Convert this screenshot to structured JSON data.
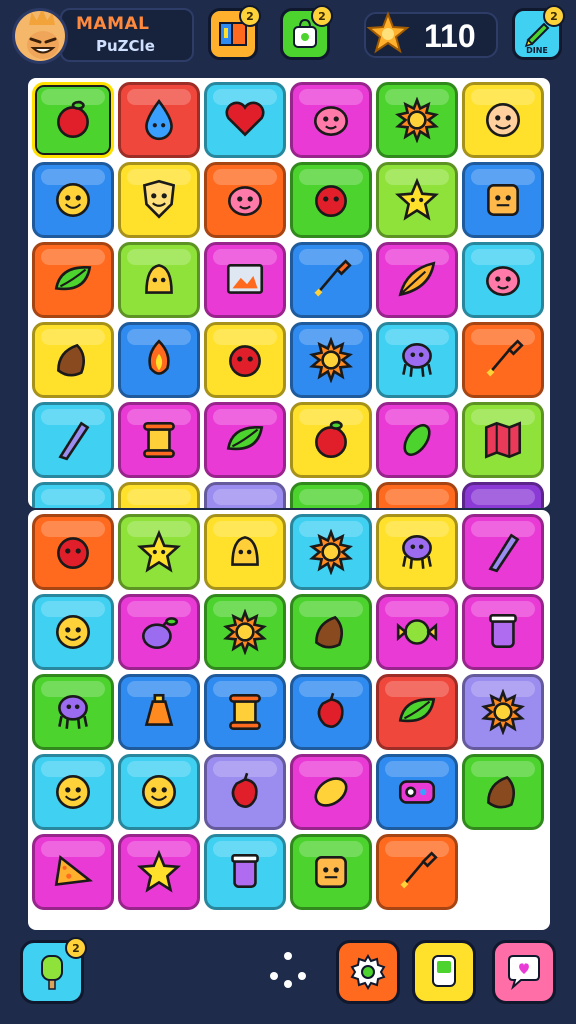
{
  "header": {
    "player_name": "MAMAL",
    "player_subtitle": "PuZCle",
    "coins": "110",
    "badges": {
      "map": "2",
      "shop": "2",
      "edit": "2",
      "hint": "2"
    },
    "edit_label": "DINE"
  },
  "colors": {
    "background": "#1f2b4a",
    "green": "#4cd32e",
    "red": "#f0473c",
    "cyan": "#3fd0f2",
    "magenta": "#e93ad6",
    "yellow": "#ffe02a",
    "orange": "#ff6a1f",
    "blue": "#2f8bf0",
    "lime": "#8fe23a",
    "lavender": "#9b8cf0",
    "purple": "#8c3ad6"
  },
  "board_top": [
    [
      {
        "color": "green",
        "icon": "apple-icon"
      },
      {
        "color": "red",
        "icon": "water-drop-icon"
      },
      {
        "color": "cyan",
        "icon": "heart-icon"
      },
      {
        "color": "magenta",
        "icon": "blob-face-icon"
      },
      {
        "color": "green",
        "icon": "sun-icon"
      },
      {
        "color": "yellow",
        "icon": "face-icon"
      }
    ],
    [
      {
        "color": "blue",
        "icon": "smiley-icon"
      },
      {
        "color": "yellow",
        "icon": "shield-face-icon"
      },
      {
        "color": "orange",
        "icon": "blob-face-icon"
      },
      {
        "color": "green",
        "icon": "tomato-icon"
      },
      {
        "color": "lime",
        "icon": "star-face-icon"
      },
      {
        "color": "blue",
        "icon": "box-face-icon"
      }
    ],
    [
      {
        "color": "orange",
        "icon": "leaf-icon"
      },
      {
        "color": "lime",
        "icon": "bell-face-icon"
      },
      {
        "color": "magenta",
        "icon": "picture-icon"
      },
      {
        "color": "blue",
        "icon": "brush-icon"
      },
      {
        "color": "magenta",
        "icon": "feather-icon"
      },
      {
        "color": "cyan",
        "icon": "blob-face-icon"
      }
    ],
    [
      {
        "color": "yellow",
        "icon": "nut-icon"
      },
      {
        "color": "blue",
        "icon": "flame-icon"
      },
      {
        "color": "yellow",
        "icon": "tomato-icon"
      },
      {
        "color": "blue",
        "icon": "sun-icon"
      },
      {
        "color": "cyan",
        "icon": "octopus-icon"
      },
      {
        "color": "orange",
        "icon": "brush-icon"
      }
    ],
    [
      {
        "color": "cyan",
        "icon": "crystal-icon"
      },
      {
        "color": "magenta",
        "icon": "scroll-icon"
      },
      {
        "color": "magenta",
        "icon": "leaf-icon"
      },
      {
        "color": "yellow",
        "icon": "apple-icon"
      },
      {
        "color": "magenta",
        "icon": "pickle-icon"
      },
      {
        "color": "lime",
        "icon": "map-icon"
      }
    ]
  ],
  "board_top_peek": [
    "cyan",
    "yellow",
    "lavender",
    "green",
    "orange",
    "purple"
  ],
  "board_bottom": [
    [
      {
        "color": "orange",
        "icon": "tomato-icon"
      },
      {
        "color": "lime",
        "icon": "star-face-icon"
      },
      {
        "color": "yellow",
        "icon": "bell-face-icon"
      },
      {
        "color": "cyan",
        "icon": "sun-icon"
      },
      {
        "color": "yellow",
        "icon": "octopus-icon"
      },
      {
        "color": "magenta",
        "icon": "crystal-icon"
      }
    ],
    [
      {
        "color": "cyan",
        "icon": "smiley-icon"
      },
      {
        "color": "magenta",
        "icon": "plum-icon"
      },
      {
        "color": "green",
        "icon": "sun-icon"
      },
      {
        "color": "green",
        "icon": "nut-icon"
      },
      {
        "color": "magenta",
        "icon": "candy-icon"
      },
      {
        "color": "magenta",
        "icon": "jar-icon"
      }
    ],
    [
      {
        "color": "green",
        "icon": "octopus-icon"
      },
      {
        "color": "blue",
        "icon": "bell-icon"
      },
      {
        "color": "blue",
        "icon": "scroll-icon"
      },
      {
        "color": "blue",
        "icon": "pepper-icon"
      },
      {
        "color": "red",
        "icon": "leaf-icon"
      },
      {
        "color": "lavender",
        "icon": "sun-icon"
      }
    ],
    [
      {
        "color": "cyan",
        "icon": "smiley-icon"
      },
      {
        "color": "cyan",
        "icon": "smiley-icon"
      },
      {
        "color": "lavender",
        "icon": "pepper-icon"
      },
      {
        "color": "magenta",
        "icon": "lemon-icon"
      },
      {
        "color": "blue",
        "icon": "gadget-icon"
      },
      {
        "color": "green",
        "icon": "nut-icon"
      }
    ],
    [
      {
        "color": "magenta",
        "icon": "cheese-icon"
      },
      {
        "color": "magenta",
        "icon": "star-icon"
      },
      {
        "color": "cyan",
        "icon": "jar-icon"
      },
      {
        "color": "green",
        "icon": "box-face-icon"
      },
      {
        "color": "orange",
        "icon": "brush-icon"
      },
      {
        "color": "empty",
        "icon": ""
      }
    ]
  ]
}
